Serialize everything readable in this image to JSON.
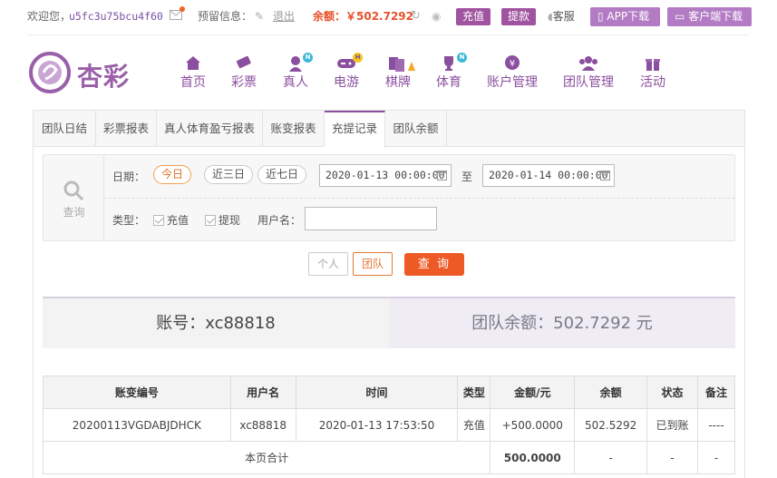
{
  "topbar": {
    "welcome": "欢迎您，",
    "username": "u5fc3u75bcu4f60",
    "reserve_label": "预留信息：",
    "logout": "退出",
    "balance": "余额：￥502.7292",
    "deposit": "充值",
    "withdraw": "提款",
    "service": "客服",
    "app_download": "APP下载",
    "client_download": "客户端下载"
  },
  "logo": {
    "text": "杏彩"
  },
  "nav": [
    {
      "label": "首页",
      "icon": "home-icon",
      "badge": ""
    },
    {
      "label": "彩票",
      "icon": "ticket-icon",
      "badge": ""
    },
    {
      "label": "真人",
      "icon": "dealer-icon",
      "badge": "N"
    },
    {
      "label": "电游",
      "icon": "gamepad-icon",
      "badge": "H"
    },
    {
      "label": "棋牌",
      "icon": "cards-icon",
      "badge": ""
    },
    {
      "label": "体育",
      "icon": "trophy-icon",
      "badge": "N"
    },
    {
      "label": "账户管理",
      "icon": "account-icon",
      "badge": ""
    },
    {
      "label": "团队管理",
      "icon": "team-icon",
      "badge": ""
    },
    {
      "label": "活动",
      "icon": "gift-icon",
      "badge": ""
    }
  ],
  "tabs": [
    {
      "label": "团队日结"
    },
    {
      "label": "彩票报表"
    },
    {
      "label": "真人体育盈亏报表"
    },
    {
      "label": "账变报表"
    },
    {
      "label": "充提记录",
      "active": true
    },
    {
      "label": "团队余额"
    }
  ],
  "filter": {
    "query_label": "查询",
    "date_label": "日期：",
    "date_options": [
      "今日",
      "近三日",
      "近七日"
    ],
    "date_selected": "今日",
    "date_from": "2020-01-13 00:00:00",
    "date_to_label": "至",
    "date_to": "2020-01-14 00:00:00",
    "type_label": "类型：",
    "type_options": [
      "充值",
      "提现"
    ],
    "username_label": "用户名：",
    "username_value": ""
  },
  "actions": {
    "person": "个人",
    "team": "团队",
    "query": "查 询"
  },
  "summary": {
    "account": "账号：xc88818",
    "team_balance": "团队余额：502.7292 元"
  },
  "table": {
    "headers": [
      "账变编号",
      "用户名",
      "时间",
      "类型",
      "金额/元",
      "余额",
      "状态",
      "备注"
    ],
    "rows": [
      [
        "20200113VGDABJDHCK",
        "xc88818",
        "2020-01-13 17:53:50",
        "充值",
        "+500.0000",
        "502.5292",
        "已到账",
        "----"
      ]
    ],
    "total": {
      "label": "本页合计",
      "amount": "500.0000",
      "balance": "-",
      "status": "-",
      "note": "-"
    }
  },
  "colors": {
    "brand": "#8a4f9e",
    "accent": "#ee5a26",
    "balance": "#e8502a",
    "success": "#3a9a3a"
  }
}
